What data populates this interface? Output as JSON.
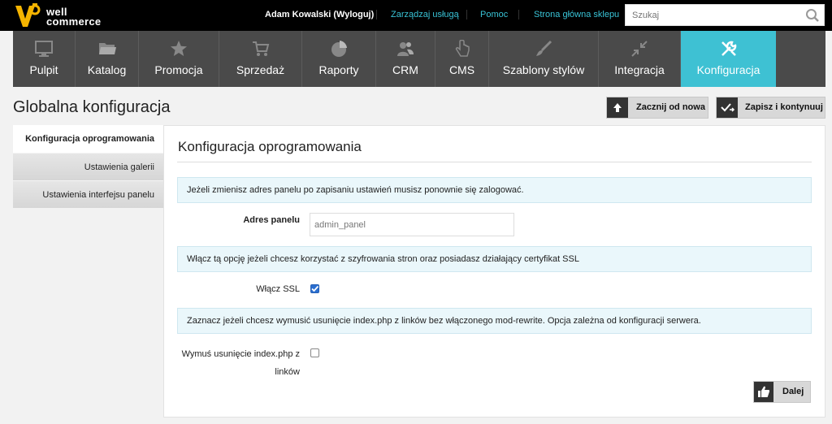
{
  "brand": {
    "line1": "well",
    "line2": "commerce",
    "accent": "#f5b400"
  },
  "topbar": {
    "user_name": "Adam Kowalski",
    "logout": "(Wyloguj)",
    "links": [
      "Zarządzaj usługą",
      "Pomoc",
      "Strona główna sklepu"
    ],
    "search_placeholder": "Szukaj",
    "link_color": "#39c3d6"
  },
  "nav": {
    "items": [
      {
        "label": "Pulpit",
        "icon": "monitor-icon"
      },
      {
        "label": "Katalog",
        "icon": "folder-icon"
      },
      {
        "label": "Promocja",
        "icon": "star-icon"
      },
      {
        "label": "Sprzedaż",
        "icon": "cart-icon"
      },
      {
        "label": "Raporty",
        "icon": "pie-chart-icon"
      },
      {
        "label": "CRM",
        "icon": "users-icon"
      },
      {
        "label": "CMS",
        "icon": "hand-icon"
      },
      {
        "label": "Szablony stylów",
        "icon": "brush-icon"
      },
      {
        "label": "Integracja",
        "icon": "arrows-icon"
      },
      {
        "label": "Konfiguracja",
        "icon": "tools-icon"
      }
    ],
    "active": "Konfiguracja",
    "active_color": "#3ec1d3"
  },
  "header": {
    "title": "Globalna konfiguracja",
    "reset_label": "Zacznij od nowa",
    "save_label": "Zapisz i kontynuuj"
  },
  "sidebar": {
    "items": [
      {
        "label": "Konfiguracja oprogramowania",
        "active": true
      },
      {
        "label": "Ustawienia galerii",
        "active": false
      },
      {
        "label": "Ustawienia interfejsu panelu",
        "active": false
      }
    ]
  },
  "main": {
    "title": "Konfiguracja oprogramowania",
    "info1": "Jeżeli zmienisz adres panelu po zapisaniu ustawień musisz ponownie się zalogować.",
    "admin_label": "Adres panelu",
    "admin_value": "admin_panel",
    "info2": "Włącz tą opcję jeżeli chcesz korzystać z szyfrowania stron oraz posiadasz działający certyfikat SSL",
    "ssl_label": "Włącz SSL",
    "ssl_checked": true,
    "info3": "Zaznacz jeżeli chcesz wymusić usunięcie index.php z linków bez włączonego mod-rewrite. Opcja zależna od konfiguracji serwera.",
    "index_label_line1": "Wymuś usunięcie index.php z",
    "index_label_line2": "linków",
    "index_checked": false,
    "next_label": "Dalej"
  }
}
